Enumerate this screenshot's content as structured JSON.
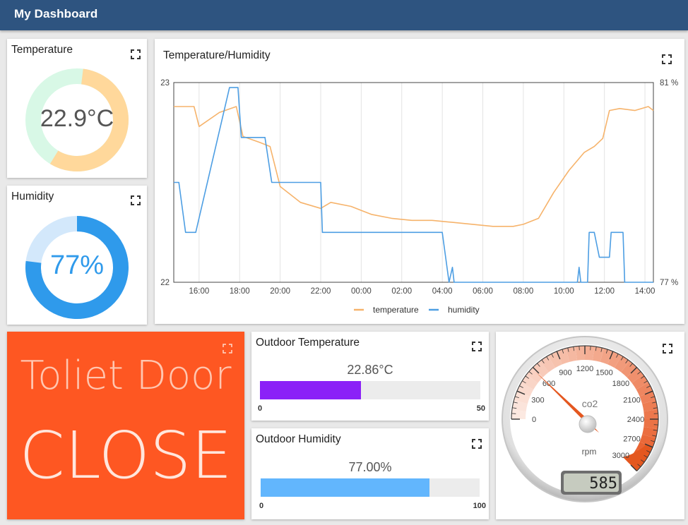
{
  "header": {
    "title": "My Dashboard"
  },
  "widgets": {
    "temperature": {
      "title": "Temperature",
      "value_text": "22.9°C",
      "color": "#ffd89b",
      "track_color": "#d8f8e6"
    },
    "humidity": {
      "title": "Humidity",
      "value_text": "77%",
      "fraction": 0.77,
      "color": "#2f9aeb",
      "track_color": "#d3e8fb"
    },
    "door": {
      "title": "Toliet Door",
      "state": "CLOSE",
      "background": "#fe5722"
    },
    "outdoor_temperature": {
      "title": "Outdoor Temperature",
      "value_text": "22.86°C",
      "min": "0",
      "max": "50",
      "fraction": 0.4572,
      "color": "#8b21f7"
    },
    "outdoor_humidity": {
      "title": "Outdoor Humidity",
      "value_text": "77.00%",
      "min": "0",
      "max": "100",
      "fraction": 0.77,
      "color": "#62b6fd"
    },
    "gauge": {
      "label": "co2",
      "unit": "rpm",
      "value": 585,
      "display": "585",
      "min": 0,
      "max": 3000,
      "scale_labels": [
        "0",
        "300",
        "600",
        "900",
        "1200",
        "1500",
        "1800",
        "2100",
        "2400",
        "2700",
        "3000"
      ]
    }
  },
  "chart_data": {
    "type": "line",
    "title": "Temperature/Humidity",
    "x_ticks": [
      "16:00",
      "18:00",
      "20:00",
      "22:00",
      "00:00",
      "02:00",
      "04:00",
      "06:00",
      "08:00",
      "10:00",
      "12:00",
      "14:00"
    ],
    "y_left": {
      "ylim": [
        22,
        23
      ],
      "tick_labels": [
        "23",
        "22"
      ]
    },
    "y_right": {
      "ylim": [
        77,
        81
      ],
      "tick_labels": [
        "81 %",
        "77 %"
      ]
    },
    "grid": true,
    "legend": "bottom",
    "x_start": "14:45",
    "x_end": "14:25",
    "series": [
      {
        "name": "temperature",
        "axis": "left",
        "color": "#f6b36b",
        "x": [
          "14:45",
          "15:15",
          "15:45",
          "16:00",
          "17:00",
          "17:50",
          "18:10",
          "19:00",
          "19:30",
          "20:00",
          "21:00",
          "22:00",
          "22:30",
          "23:30",
          "00:30",
          "01:30",
          "02:30",
          "03:30",
          "04:30",
          "05:30",
          "06:30",
          "07:30",
          "08:00",
          "08:45",
          "09:30",
          "10:15",
          "11:00",
          "11:30",
          "11:55",
          "12:15",
          "12:45",
          "13:30",
          "14:10",
          "14:25"
        ],
        "values": [
          22.88,
          22.88,
          22.88,
          22.78,
          22.85,
          22.88,
          22.73,
          22.7,
          22.68,
          22.48,
          22.4,
          22.37,
          22.4,
          22.38,
          22.34,
          22.32,
          22.31,
          22.31,
          22.3,
          22.29,
          22.28,
          22.28,
          22.29,
          22.32,
          22.45,
          22.56,
          22.65,
          22.68,
          22.72,
          22.86,
          22.87,
          22.86,
          22.88,
          22.86
        ]
      },
      {
        "name": "humidity",
        "axis": "right",
        "color": "#4d9ee3",
        "x": [
          "14:45",
          "15:00",
          "15:20",
          "15:50",
          "17:30",
          "17:55",
          "18:05",
          "19:15",
          "19:35",
          "22:00",
          "22:05",
          "04:00",
          "04:20",
          "04:30",
          "04:35",
          "10:40",
          "10:45",
          "10:50",
          "11:10",
          "11:15",
          "11:30",
          "11:45",
          "12:15",
          "12:20",
          "12:25",
          "12:55",
          "13:00",
          "14:25"
        ],
        "values": [
          79.0,
          79.0,
          78.0,
          78.0,
          80.9,
          80.9,
          79.9,
          79.9,
          79.0,
          79.0,
          78.0,
          78.0,
          77.0,
          77.3,
          77.0,
          77.0,
          77.3,
          77.0,
          77.0,
          78.0,
          78.0,
          77.5,
          77.5,
          78.0,
          78.0,
          78.0,
          77.0,
          77.0
        ]
      }
    ]
  }
}
